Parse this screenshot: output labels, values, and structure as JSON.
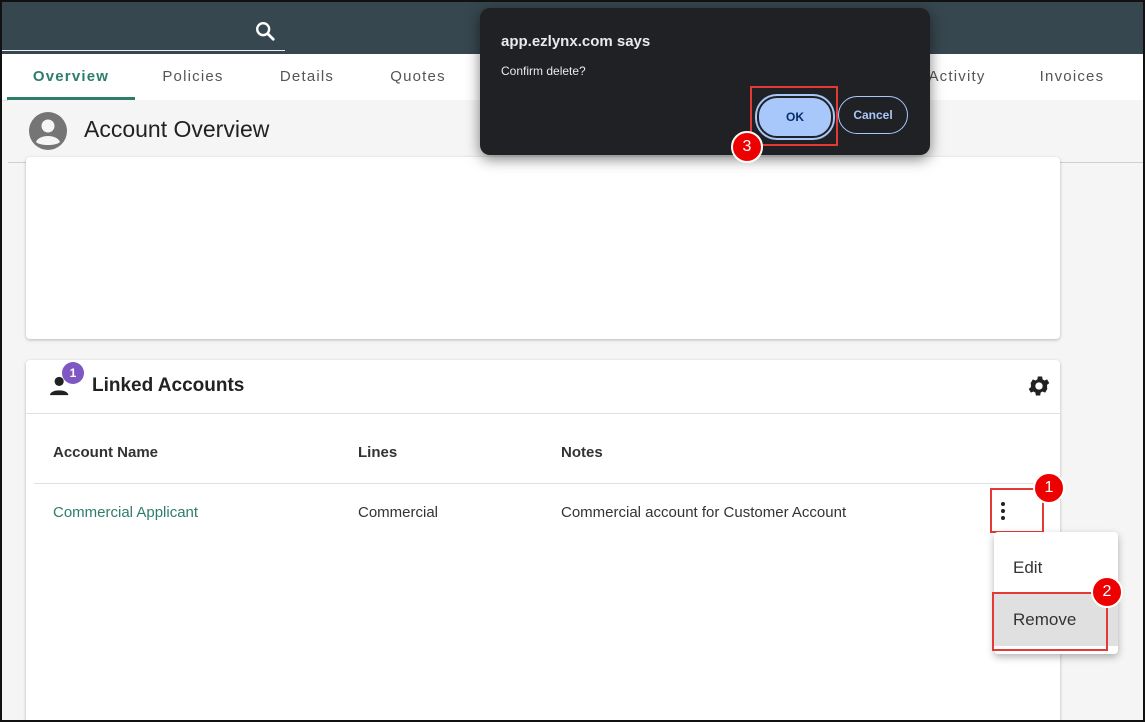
{
  "tabs": [
    {
      "label": "Overview",
      "active": true
    },
    {
      "label": "Policies"
    },
    {
      "label": "Details"
    },
    {
      "label": "Quotes"
    },
    {
      "label": "Activity"
    },
    {
      "label": "Invoices"
    }
  ],
  "page": {
    "title": "Account Overview"
  },
  "linked_accounts": {
    "title": "Linked Accounts",
    "badge_count": "1",
    "columns": [
      "Account Name",
      "Lines",
      "Notes"
    ],
    "rows": [
      {
        "name": "Commercial Applicant",
        "lines": "Commercial",
        "notes": "Commercial account for Customer Account"
      }
    ]
  },
  "row_menu": {
    "items": [
      "Edit",
      "Remove"
    ],
    "highlighted": "Remove"
  },
  "dialog": {
    "title": "app.ezlynx.com says",
    "message": "Confirm delete?",
    "ok_label": "OK",
    "cancel_label": "Cancel"
  },
  "steps": [
    "1",
    "2",
    "3"
  ],
  "icons": [
    "search-icon",
    "person-icon",
    "gear-icon",
    "more-vert-icon",
    "account-circle-icon"
  ],
  "colors": {
    "accent": "#2e7d6b",
    "topbar": "#37474f",
    "badge": "#7e57c2",
    "annotation": "#e53935",
    "dialog_bg": "#202124",
    "ok_button": "#a8c7fa"
  }
}
